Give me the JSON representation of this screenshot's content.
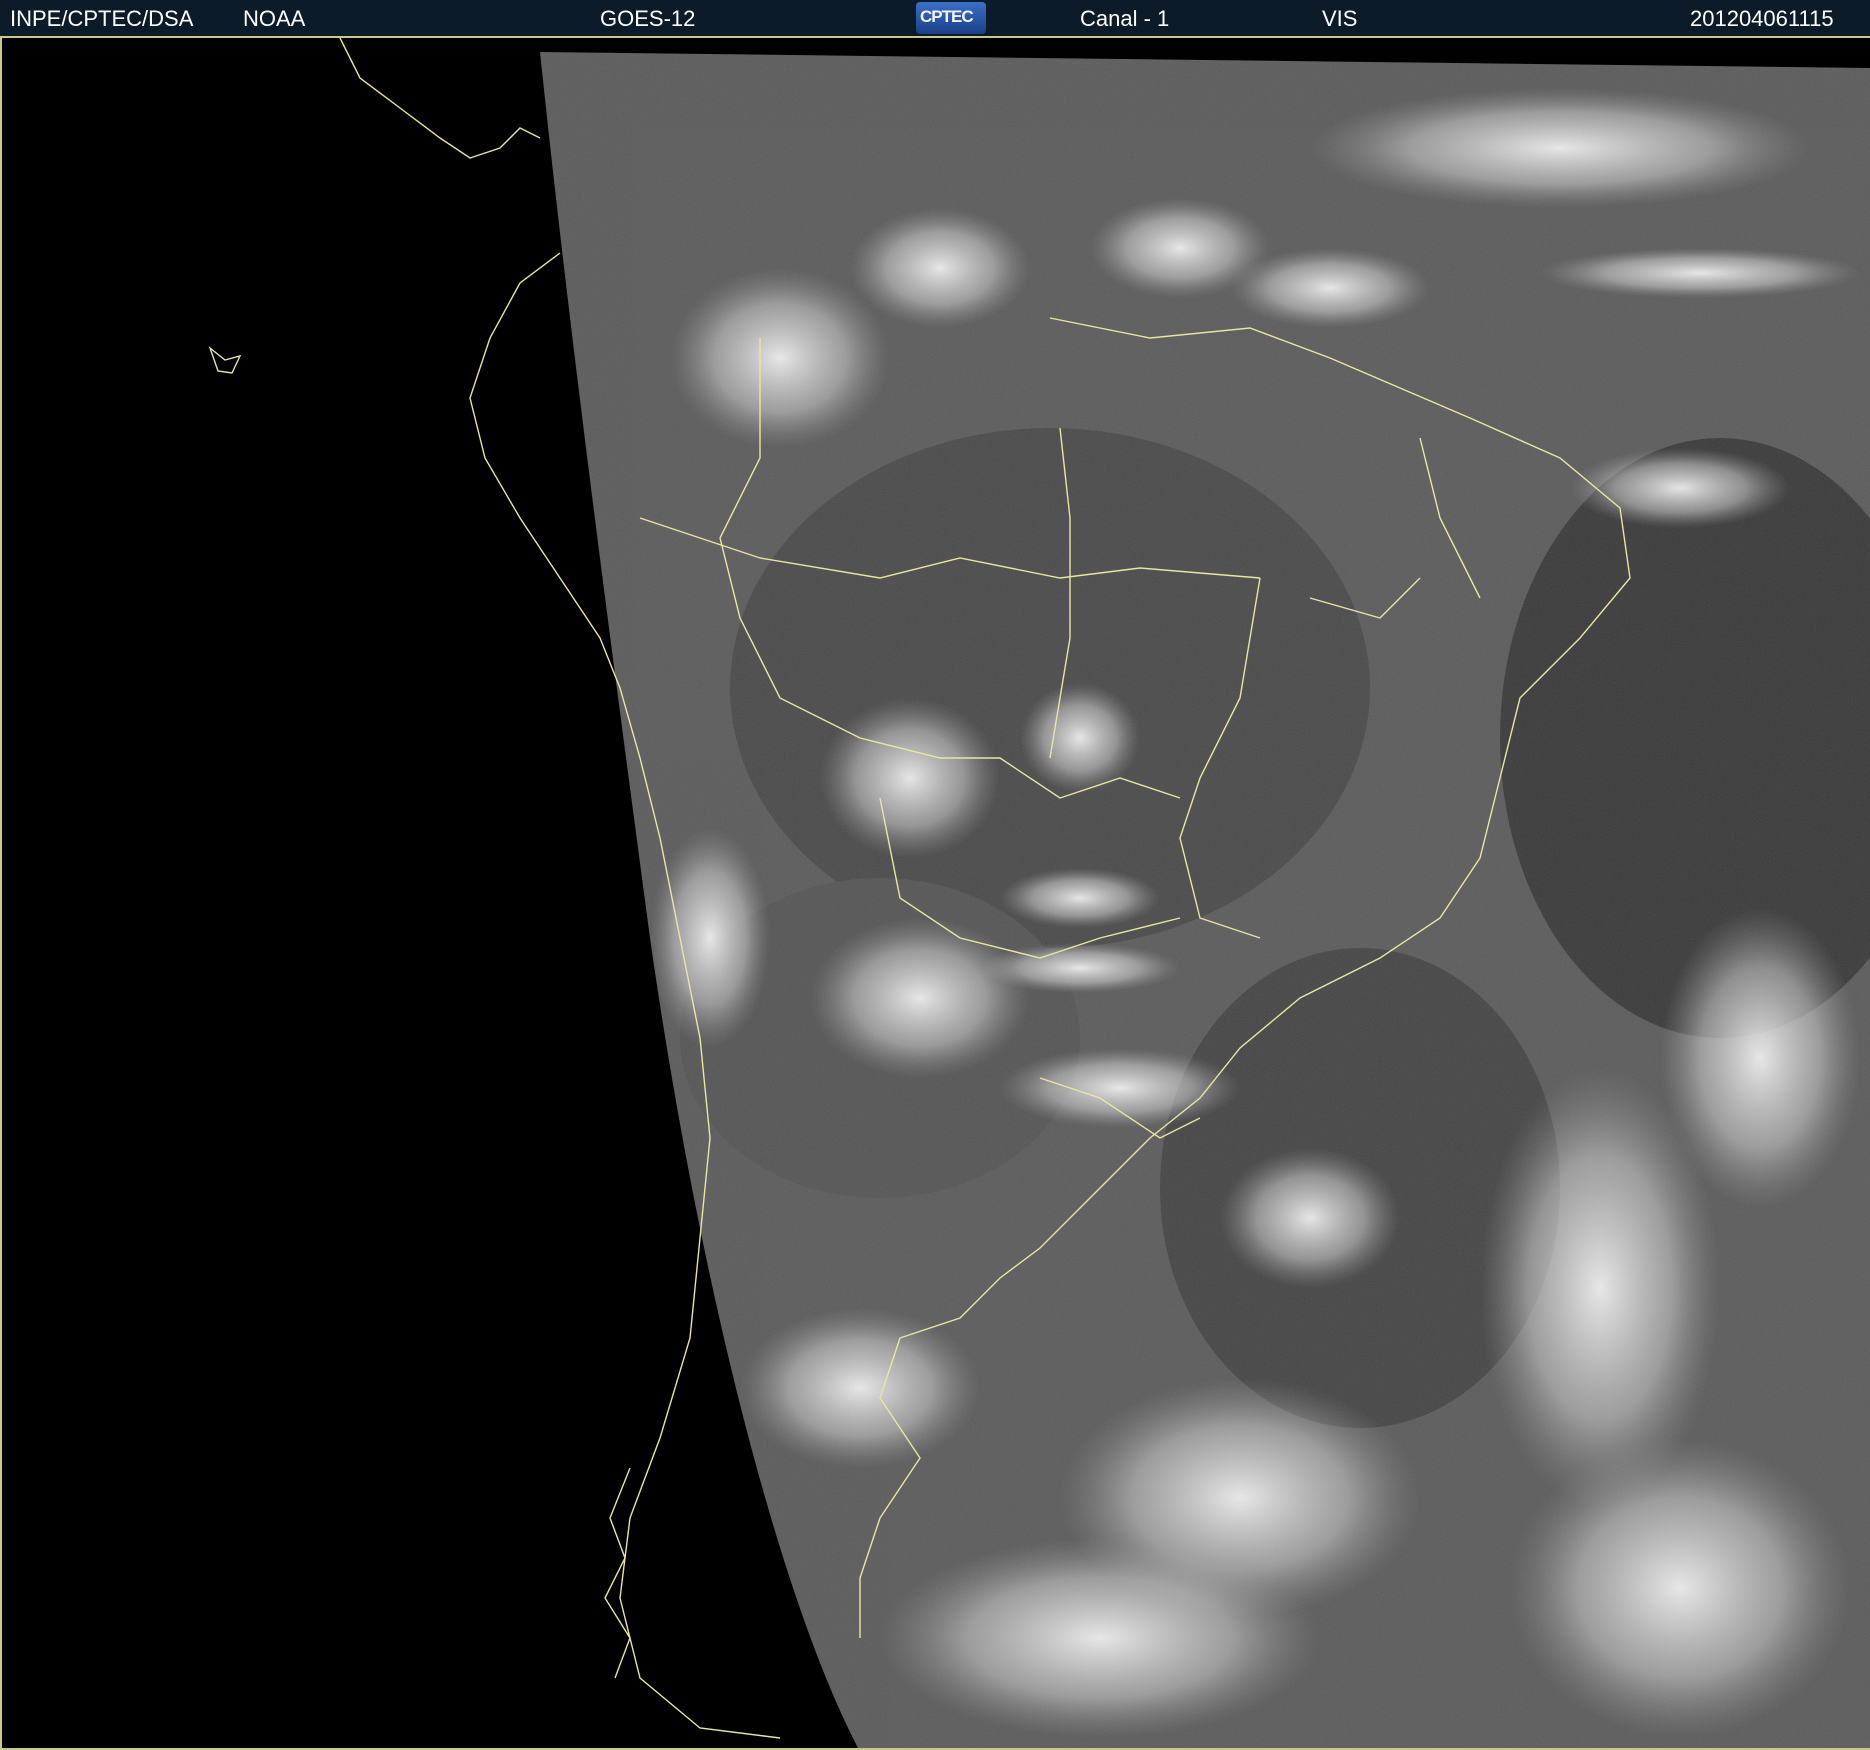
{
  "header": {
    "institution": "INPE/CPTEC/DSA",
    "agency": "NOAA",
    "satellite": "GOES-12",
    "logo_text": "CPTEC",
    "channel": "Canal - 1",
    "band": "VIS",
    "timestamp": "201204061115"
  },
  "colors": {
    "header_bg": "#0b1b2a",
    "coastline": "#e8e6a0",
    "space": "#000000"
  }
}
